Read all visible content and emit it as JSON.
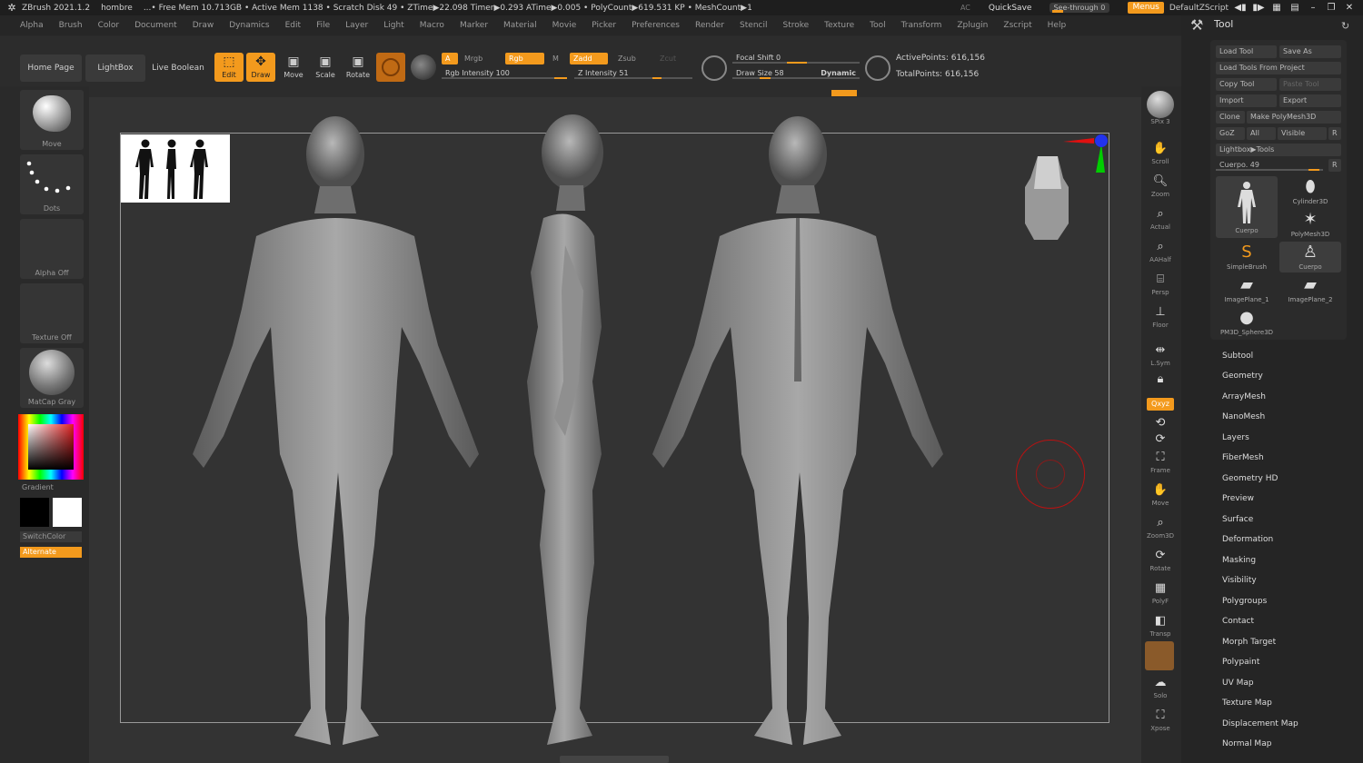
{
  "titlebar": {
    "app": "ZBrush 2021.1.2",
    "doc": "hombre",
    "stats": "...• Free Mem 10.713GB • Active Mem 1138 • Scratch Disk 49 • ZTime▶22.098 Timer▶0.293 ATime▶0.005 • PolyCount▶619.531 KP • MeshCount▶1",
    "ac": "AC",
    "quicksave": "QuickSave",
    "see_through": "See-through 0",
    "menus": "Menus",
    "zscript": "DefaultZScript"
  },
  "menu": [
    "Alpha",
    "Brush",
    "Color",
    "Document",
    "Draw",
    "Dynamics",
    "Edit",
    "File",
    "Layer",
    "Light",
    "Macro",
    "Marker",
    "Material",
    "Movie",
    "Picker",
    "Preferences",
    "Render",
    "Stencil",
    "Stroke",
    "Texture",
    "Tool",
    "Transform",
    "Zplugin",
    "Zscript",
    "Help"
  ],
  "shelf": {
    "home": "Home Page",
    "lightbox": "LightBox",
    "live_boolean": "Live Boolean",
    "edit": "Edit",
    "draw": "Draw",
    "move": "Move",
    "scale": "Scale",
    "rotate": "Rotate",
    "a": "A",
    "mrgb": "Mrgb",
    "rgb": "Rgb",
    "m": "M",
    "rgb_intensity": "Rgb Intensity 100",
    "zadd": "Zadd",
    "zsub": "Zsub",
    "zcut": "Zcut",
    "z_intensity": "Z Intensity 51",
    "focal_shift": "Focal Shift 0",
    "draw_size": "Draw Size 58",
    "dynamic": "Dynamic",
    "active_points": "ActivePoints: 616,156",
    "total_points": "TotalPoints: 616,156",
    "rgb_intensity_level": 1.0,
    "z_intensity_level": 0.51
  },
  "left": {
    "brush": "Move",
    "stroke": "Dots",
    "alpha": "Alpha Off",
    "texture": "Texture Off",
    "material": "MatCap Gray",
    "gradient": "Gradient",
    "switch": "SwitchColor",
    "alternate": "Alternate"
  },
  "right": [
    "SPix 3",
    "Scroll",
    "Zoom",
    "Actual",
    "AAHalf",
    "Persp",
    "Floor",
    "L.Sym",
    "Poly",
    "",
    "",
    "Frame",
    "Move",
    "Zoom3D",
    "Rotate",
    "PolyF",
    "Transp",
    "",
    "Solo",
    "Xpose"
  ],
  "tool": {
    "title": "Tool",
    "load": "Load Tool",
    "save_as": "Save As",
    "load_project": "Load Tools From Project",
    "copy": "Copy Tool",
    "paste": "Paste Tool",
    "import": "Import",
    "export": "Export",
    "clone": "Clone",
    "make_poly": "Make PolyMesh3D",
    "goz": "GoZ",
    "all": "All",
    "visible": "Visible",
    "r": "R",
    "lightbox_tools": "Lightbox▶Tools",
    "cuerpo_slider": "Cuerpo. 49",
    "thumbs": [
      "Cuerpo",
      "Cylinder3D",
      "PolyMesh3D",
      "SimpleBrush",
      "Cuerpo",
      "ImagePlane_1",
      "ImagePlane_2",
      "PM3D_Sphere3D"
    ],
    "subpalettes": [
      "Subtool",
      "Geometry",
      "ArrayMesh",
      "NanoMesh",
      "Layers",
      "FiberMesh",
      "Geometry HD",
      "Preview",
      "Surface",
      "Deformation",
      "Masking",
      "Visibility",
      "Polygroups",
      "Contact",
      "Morph Target",
      "Polypaint",
      "UV Map",
      "Texture Map",
      "Displacement Map",
      "Normal Map"
    ]
  }
}
